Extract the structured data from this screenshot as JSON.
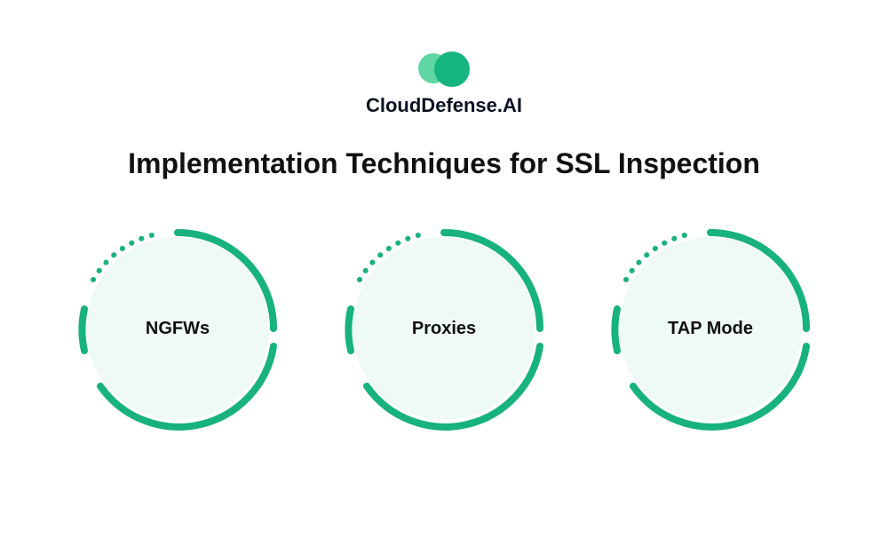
{
  "brand": {
    "name": "CloudDefense.AI",
    "colors": {
      "accent_light": "#5fd6a3",
      "accent_dark": "#17b57e",
      "text": "#0a1222",
      "circle_fill": "#effaf4",
      "ring": "#18b27c"
    }
  },
  "heading": "Implementation Techniques for SSL Inspection",
  "techniques": [
    {
      "label": "NGFWs"
    },
    {
      "label": "Proxies"
    },
    {
      "label": "TAP Mode"
    }
  ]
}
